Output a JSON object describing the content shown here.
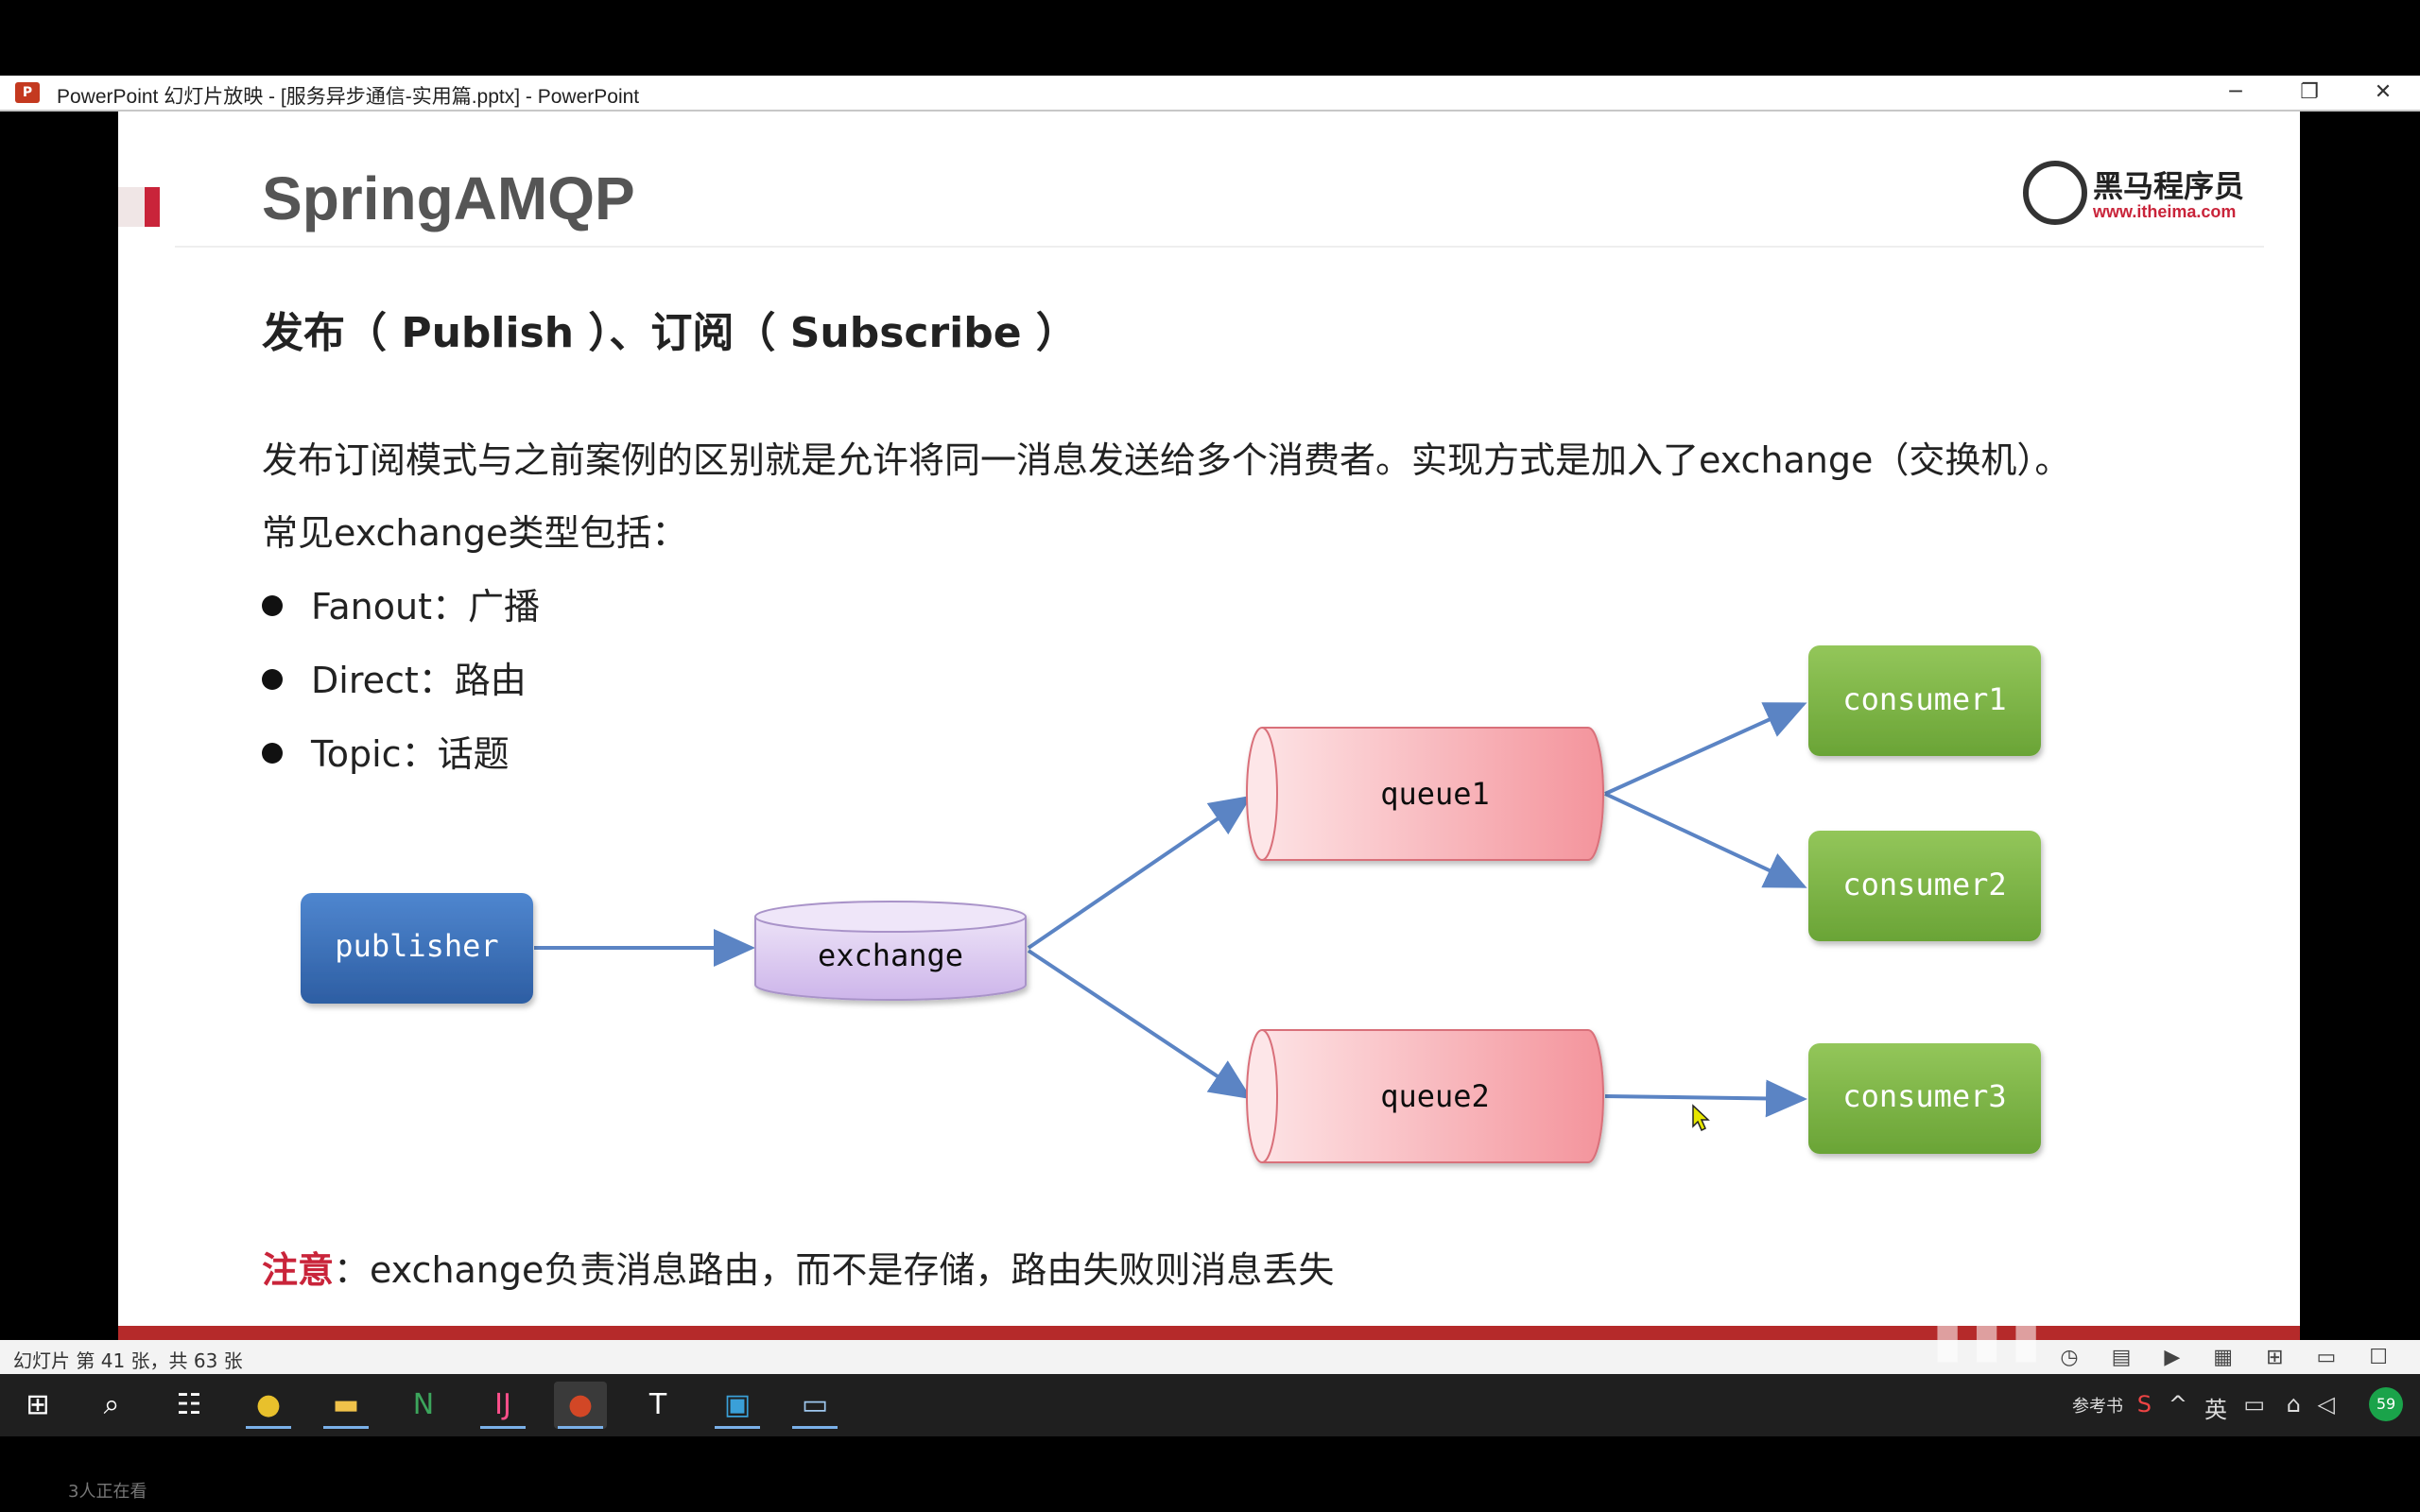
{
  "window": {
    "app_icon": "P",
    "title": "PowerPoint 幻灯片放映 - [服务异步通信-实用篇.pptx] - PowerPoint",
    "controls": {
      "minimize": "─",
      "restore": "❐",
      "close": "✕"
    }
  },
  "slide": {
    "heading": "SpringAMQP",
    "logo": {
      "brand": "黑马程序员",
      "url": "www.itheima.com"
    },
    "subtitle": "发布（ Publish ）、订阅（ Subscribe ）",
    "paragraph": "发布订阅模式与之前案例的区别就是允许将同一消息发送给多个消费者。实现方式是加入了exchange（交换机）。",
    "types_intro": "常见exchange类型包括：",
    "bullets": [
      "Fanout：广播",
      "Direct：路由",
      "Topic：话题"
    ],
    "diagram": {
      "publisher": "publisher",
      "exchange": "exchange",
      "queue1": "queue1",
      "queue2": "queue2",
      "consumer1": "consumer1",
      "consumer2": "consumer2",
      "consumer3": "consumer3"
    },
    "note_label": "注意",
    "note_text": "：exchange负责消息路由，而不是存储，路由失败则消息丢失"
  },
  "statusbar": {
    "slide_info": "幻灯片 第 41 张，共 63 张"
  },
  "taskbar": {
    "tray_label": "参考书",
    "ime": "英",
    "badge": "59"
  },
  "viewers": "3人正在看",
  "colors": {
    "accent_red": "#c9243a",
    "publisher_blue": "#3b6fb6",
    "consumer_green": "#7cb342",
    "queue_pink": "#f7a7ad",
    "exchange_purple": "#d9c8ef",
    "arrow_blue": "#5b84c4"
  }
}
